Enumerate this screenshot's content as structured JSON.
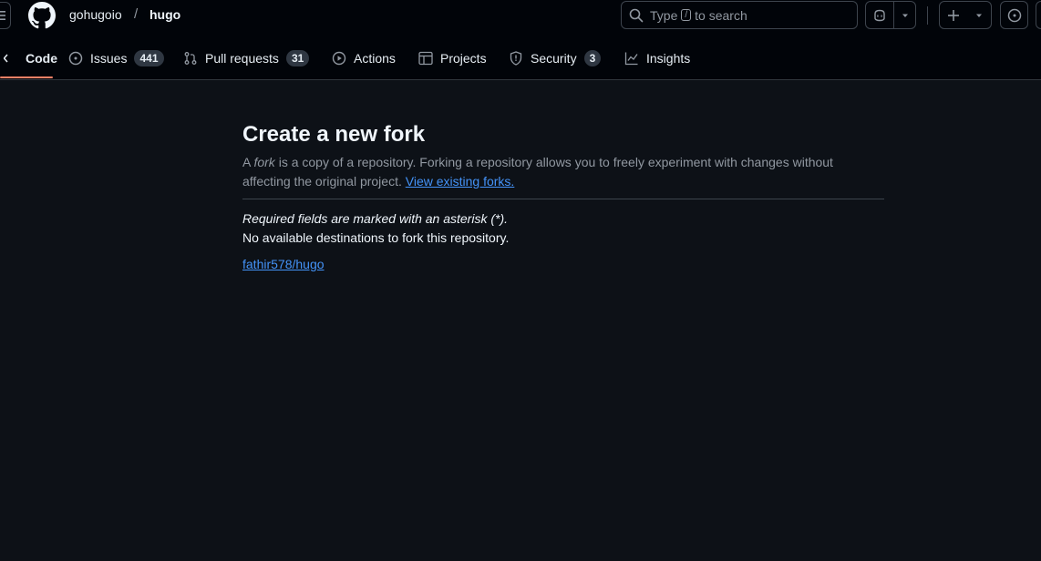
{
  "header": {
    "owner": "gohugoio",
    "separator": "/",
    "repo": "hugo",
    "search": {
      "prefix": "Type",
      "key": "/",
      "suffix": "to search"
    }
  },
  "tabs": [
    {
      "label": "Code"
    },
    {
      "label": "Issues",
      "count": "441"
    },
    {
      "label": "Pull requests",
      "count": "31"
    },
    {
      "label": "Actions"
    },
    {
      "label": "Projects"
    },
    {
      "label": "Security",
      "count": "3"
    },
    {
      "label": "Insights"
    }
  ],
  "main": {
    "title": "Create a new fork",
    "desc_a": "A ",
    "desc_fork": "fork",
    "desc_b": " is a copy of a repository. Forking a repository allows you to freely experiment with changes without affecting the original project. ",
    "view_forks": "View existing forks.",
    "required_note": "Required fields are marked with an asterisk (*).",
    "no_destinations": "No available destinations to fork this repository.",
    "existing_fork": "fathir578/hugo"
  },
  "colors": {
    "accent_underline": "#f78166",
    "link": "#4493f8",
    "background": "#0d1117"
  },
  "icons": [
    "menu-icon",
    "github-logo-icon",
    "search-icon",
    "copilot-icon",
    "triangle-down-icon",
    "plus-icon",
    "issue-opened-icon",
    "code-icon",
    "git-pull-request-icon",
    "play-icon",
    "table-icon",
    "shield-icon",
    "graph-icon"
  ]
}
